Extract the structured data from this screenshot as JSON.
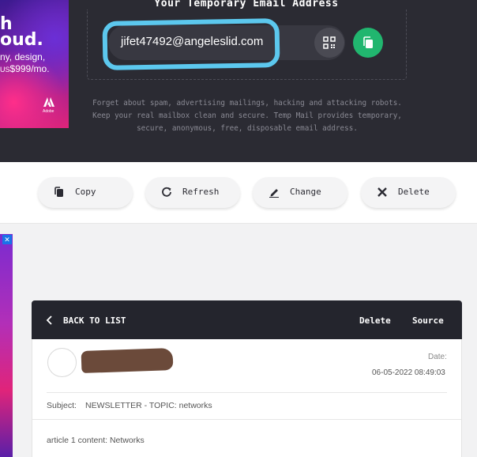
{
  "ad_top": {
    "line1": "h",
    "line2": "oud.",
    "line3": "ny, design,",
    "price_currency": "US",
    "price": "$999/mo.",
    "brand": "Adobe"
  },
  "hero": {
    "title": "Your Temporary Email Address",
    "email": "jifet47492@angeleslid.com",
    "description": "Forget about spam, advertising mailings, hacking and attacking robots. Keep your real mailbox clean and secure. Temp Mail provides temporary, secure, anonymous, free, disposable email address."
  },
  "toolbar": {
    "copy_label": "Copy",
    "refresh_label": "Refresh",
    "change_label": "Change",
    "delete_label": "Delete"
  },
  "ad_side": {
    "close": "✕"
  },
  "mail": {
    "back_label": "BACK TO LIST",
    "delete_label": "Delete",
    "source_label": "Source",
    "date_label": "Date:",
    "date_value": "06-05-2022 08:49:03",
    "subject_label": "Subject:",
    "subject_value": "NEWSLETTER - TOPIC: networks",
    "content": "article 1 content: Networks"
  },
  "colors": {
    "header_bg": "#2b2b33",
    "highlight": "#5cc8ee",
    "copy_accent": "#21b66f",
    "mail_header_bg": "#24252d"
  }
}
